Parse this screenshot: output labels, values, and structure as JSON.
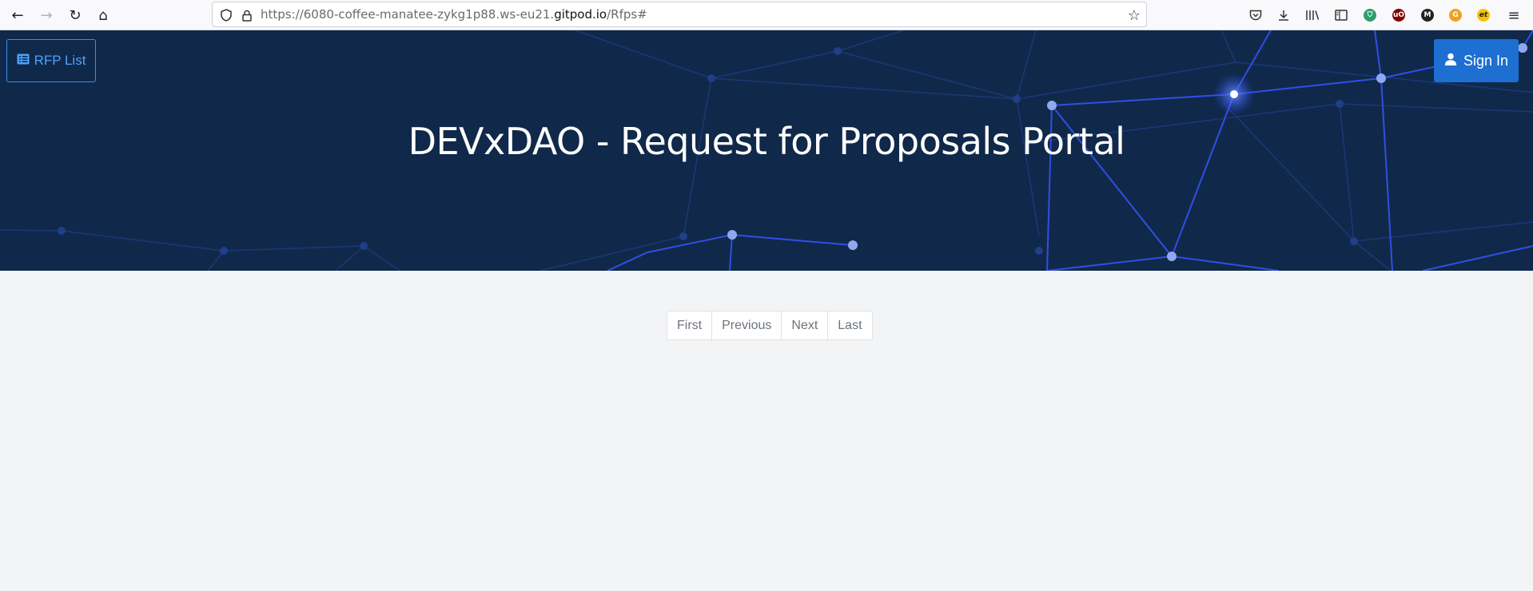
{
  "browser": {
    "url_prefix": "https://6080-coffee-manatee-zykg1p88.ws-eu21.",
    "url_domain": "gitpod.io",
    "url_suffix": "/Rfps#",
    "extensions": [
      {
        "name": "ext-shield",
        "color": "#2e9e6b",
        "glyph": "⛉"
      },
      {
        "name": "ext-ublock",
        "color": "#800000",
        "glyph": "uO"
      },
      {
        "name": "ext-m",
        "color": "#222222",
        "glyph": "M"
      },
      {
        "name": "ext-g",
        "color": "#f0a020",
        "glyph": "G"
      },
      {
        "name": "ext-et",
        "color": "#f5c400",
        "glyph": "et"
      }
    ]
  },
  "header": {
    "rfp_list_label": "RFP List",
    "sign_in_label": "Sign In",
    "title": "DEVxDAO - Request for Proposals Portal"
  },
  "pagination": {
    "first": "First",
    "previous": "Previous",
    "next": "Next",
    "last": "Last"
  },
  "colors": {
    "hero_bg": "#10294a",
    "accent": "#1d6fd1",
    "network_line": "#2f4fe6",
    "network_node": "#8fa8ef"
  }
}
